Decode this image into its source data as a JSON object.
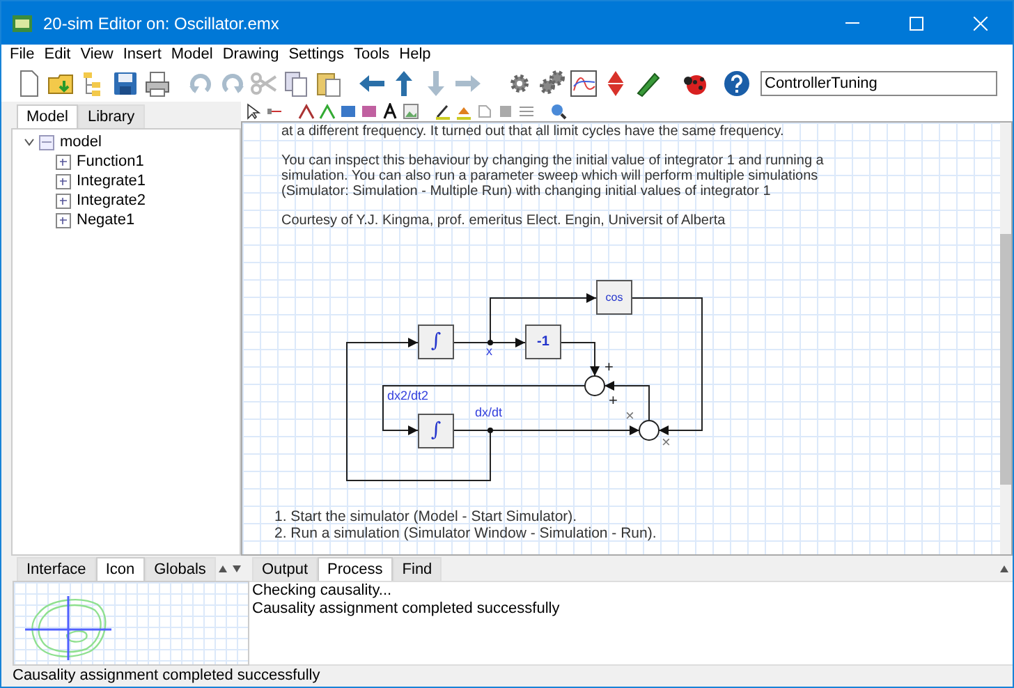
{
  "window": {
    "title": "20-sim Editor on: Oscillator.emx"
  },
  "menu": [
    "File",
    "Edit",
    "View",
    "Insert",
    "Model",
    "Drawing",
    "Settings",
    "Tools",
    "Help"
  ],
  "search": {
    "value": "ControllerTuning"
  },
  "left_tabs": [
    {
      "label": "Model",
      "selected": true
    },
    {
      "label": "Library",
      "selected": false
    }
  ],
  "tree": [
    {
      "label": "model",
      "expanded": true,
      "children": [
        {
          "label": "Function1"
        },
        {
          "label": "Integrate1"
        },
        {
          "label": "Integrate2"
        },
        {
          "label": "Negate1"
        }
      ]
    }
  ],
  "canvas": {
    "description": [
      "at a different frequency. It turned out that all limit cycles have the same frequency.",
      "You can inspect this behaviour by changing the initial value of integrator 1 and running a simulation. You can also run a parameter sweep which will perform multiple simulations (Simulator: Simulation - Multiple Run) with changing initial values of integrator 1",
      "Courtesy of Y.J. Kingma, prof. emeritus Elect. Engin, Universit of Alberta"
    ],
    "blocks": [
      {
        "kind": "integral",
        "label": "∫"
      },
      {
        "kind": "gain",
        "label": "-1"
      },
      {
        "kind": "function",
        "label": "cos"
      },
      {
        "kind": "integral",
        "label": "∫"
      }
    ],
    "signals": [
      "x",
      "dx2/dt2",
      "dx/dt"
    ],
    "signs": [
      "+",
      "+",
      "×",
      "×"
    ],
    "steps": [
      "1. Start the simulator (Model - Start Simulator).",
      "2. Run a simulation (Simulator Window - Simulation - Run)."
    ]
  },
  "bottom_left_tabs": [
    {
      "label": "Interface",
      "selected": false
    },
    {
      "label": "Icon",
      "selected": true
    },
    {
      "label": "Globals",
      "selected": false
    }
  ],
  "output_tabs": [
    {
      "label": "Output",
      "selected": false
    },
    {
      "label": "Process",
      "selected": true
    },
    {
      "label": "Find",
      "selected": false
    }
  ],
  "output_lines": [
    "Checking causality...",
    "Causality assignment completed successfully"
  ],
  "status_bar": "Causality assignment completed successfully"
}
